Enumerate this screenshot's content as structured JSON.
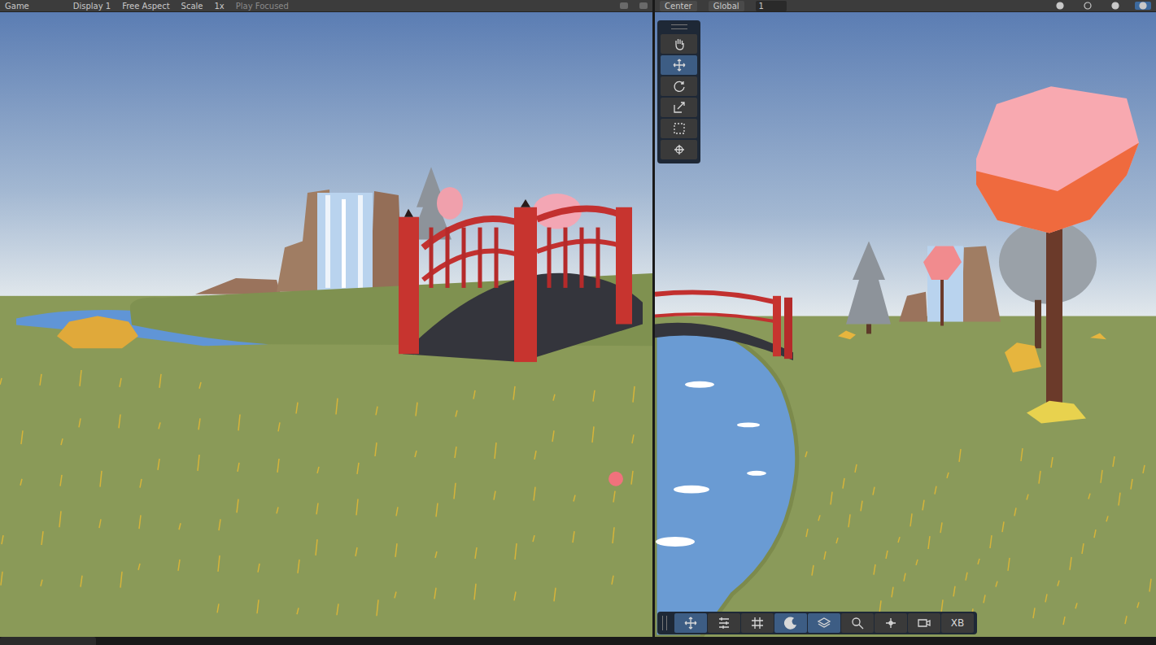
{
  "game_view": {
    "toolbar": {
      "tab": "Game",
      "display": "Display 1",
      "aspect": "Free Aspect",
      "scale_label": "Scale",
      "scale": "1x",
      "play_mode": "Play Focused"
    }
  },
  "scene_view": {
    "toolbar": {
      "pivot": "Center",
      "space": "Global",
      "grid_snap": "1"
    },
    "view_buttons": [
      {
        "kind": "globe",
        "selected": false
      },
      {
        "kind": "wire",
        "selected": false
      },
      {
        "kind": "solid",
        "selected": false
      },
      {
        "kind": "lit",
        "selected": true
      }
    ],
    "tools": [
      {
        "kind": "hand",
        "selected": false
      },
      {
        "kind": "move",
        "selected": true
      },
      {
        "kind": "rotate",
        "selected": false
      },
      {
        "kind": "scale",
        "selected": false
      },
      {
        "kind": "rect",
        "selected": false
      },
      {
        "kind": "transform",
        "selected": false
      }
    ],
    "overlay_buttons": [
      {
        "kind": "move",
        "selected": true
      },
      {
        "kind": "settings",
        "selected": false
      },
      {
        "kind": "grid",
        "selected": false
      },
      {
        "kind": "lighting",
        "selected": true
      },
      {
        "kind": "layers",
        "selected": true
      },
      {
        "kind": "search",
        "selected": false
      },
      {
        "kind": "pivot",
        "selected": false
      },
      {
        "kind": "camera",
        "selected": false
      },
      {
        "kind": "text",
        "label": "XB",
        "selected": false
      }
    ]
  }
}
